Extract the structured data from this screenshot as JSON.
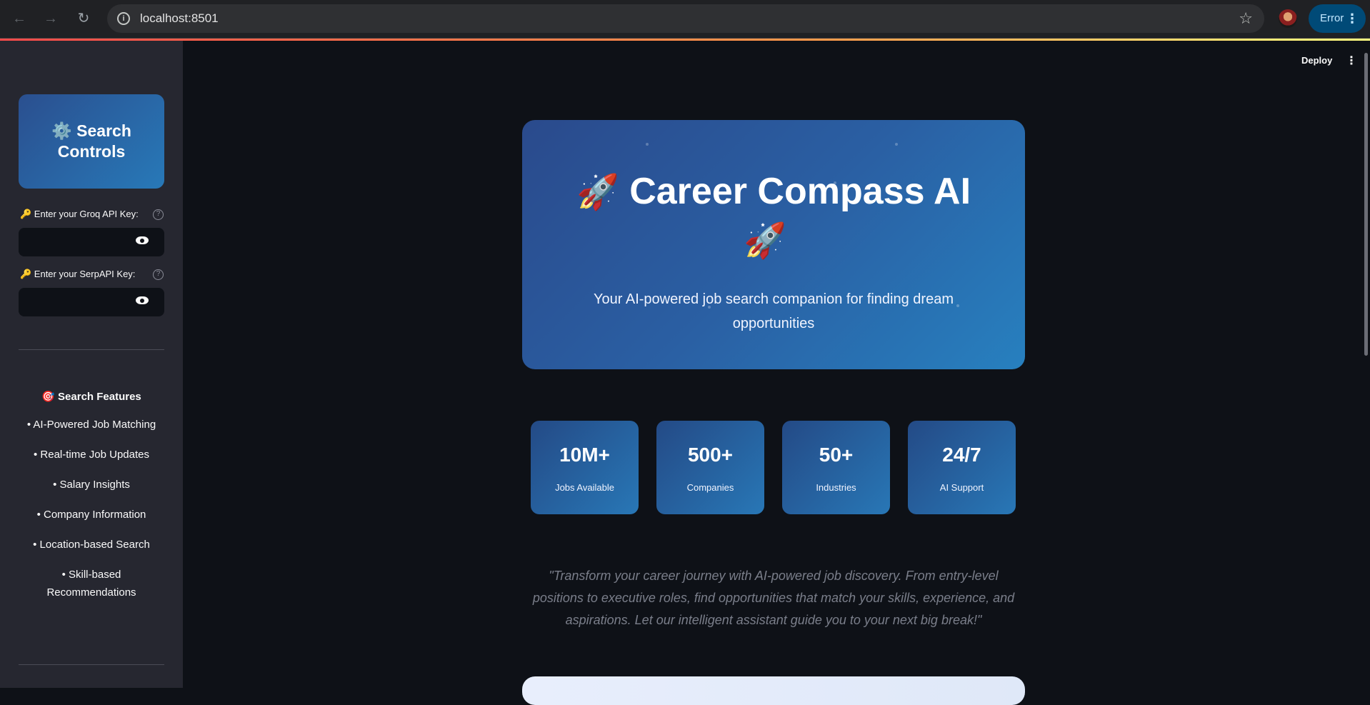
{
  "browser": {
    "url": "localhost:8501",
    "error_label": "Error",
    "icons": {
      "back": "arrow-left-icon",
      "forward": "arrow-right-icon",
      "reload": "reload-icon",
      "info": "info-icon",
      "bookmark": "star-icon",
      "menu": "kebab-icon"
    }
  },
  "sidebar": {
    "header": "⚙️ Search Controls",
    "groq_label": "🔑 Enter your Groq API Key:",
    "serp_label": "🔑 Enter your SerpAPI Key:",
    "help": "?",
    "features_title": "🎯 Search Features",
    "features": [
      "• AI-Powered Job Matching",
      "• Real-time Job Updates",
      "• Salary Insights",
      "• Company Information",
      "• Location-based Search",
      "• Skill-based Recommendations"
    ]
  },
  "toolbar": {
    "deploy": "Deploy",
    "menu": "⋮"
  },
  "hero": {
    "title": "Career Compass AI",
    "rocket": "🚀",
    "subtitle": "Your AI-powered job search companion for finding dream opportunities"
  },
  "stats": [
    {
      "value": "10M+",
      "label": "Jobs Available"
    },
    {
      "value": "500+",
      "label": "Companies"
    },
    {
      "value": "50+",
      "label": "Industries"
    },
    {
      "value": "24/7",
      "label": "AI Support"
    }
  ],
  "quote": "\"Transform your career journey with AI-powered job discovery. From entry-level positions to executive roles, find opportunities that match your skills, experience, and aspirations. Let our intelligent assistant guide you to your next big break!\""
}
